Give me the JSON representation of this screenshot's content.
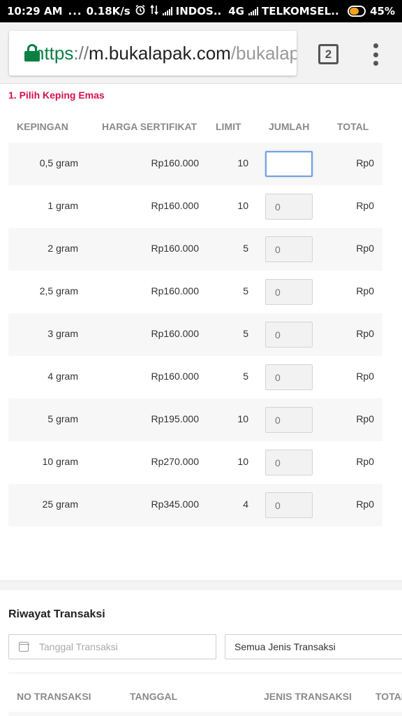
{
  "status_bar": {
    "time": "10:29 AM",
    "dots": "...",
    "speed": "0.18K/s",
    "carrier1": "INDOS..",
    "network": "4G",
    "carrier2": "TELKOMSEL..",
    "battery": "45%",
    "battery_level": 0.45,
    "battery_color": "#f7a21b"
  },
  "browser": {
    "url_scheme": "https",
    "url_sep": "://",
    "url_host": "m.bukalapak.com",
    "url_path": "/bukalapak-emas",
    "tab_count": "2",
    "lock_color": "#0b8043"
  },
  "section": {
    "title": "1. Pilih Keping Emas",
    "title_color": "#d71149",
    "columns": {
      "kepingan": "KEPINGAN",
      "harga": "HARGA SERTIFIKAT",
      "limit": "LIMIT",
      "jumlah": "JUMLAH",
      "total": "TOTAL"
    },
    "rows": [
      {
        "kepingan": "0,5 gram",
        "harga": "Rp160.000",
        "limit": "10",
        "jumlah": "",
        "total": "Rp0"
      },
      {
        "kepingan": "1 gram",
        "harga": "Rp160.000",
        "limit": "10",
        "jumlah": "0",
        "total": "Rp0"
      },
      {
        "kepingan": "2 gram",
        "harga": "Rp160.000",
        "limit": "5",
        "jumlah": "0",
        "total": "Rp0"
      },
      {
        "kepingan": "2,5 gram",
        "harga": "Rp160.000",
        "limit": "5",
        "jumlah": "0",
        "total": "Rp0"
      },
      {
        "kepingan": "3 gram",
        "harga": "Rp160.000",
        "limit": "5",
        "jumlah": "0",
        "total": "Rp0"
      },
      {
        "kepingan": "4 gram",
        "harga": "Rp160.000",
        "limit": "5",
        "jumlah": "0",
        "total": "Rp0"
      },
      {
        "kepingan": "5 gram",
        "harga": "Rp195.000",
        "limit": "10",
        "jumlah": "0",
        "total": "Rp0"
      },
      {
        "kepingan": "10 gram",
        "harga": "Rp270.000",
        "limit": "10",
        "jumlah": "0",
        "total": "Rp0"
      },
      {
        "kepingan": "25 gram",
        "harga": "Rp345.000",
        "limit": "4",
        "jumlah": "0",
        "total": "Rp0"
      }
    ]
  },
  "history": {
    "title": "Riwayat Transaksi",
    "date_placeholder": "Tanggal Transaksi",
    "type_value": "Semua Jenis Transaksi",
    "columns": {
      "no": "NO TRANSAKSI",
      "tanggal": "TANGGAL",
      "jenis": "JENIS TRANSAKSI",
      "total": "TOTAL"
    }
  }
}
